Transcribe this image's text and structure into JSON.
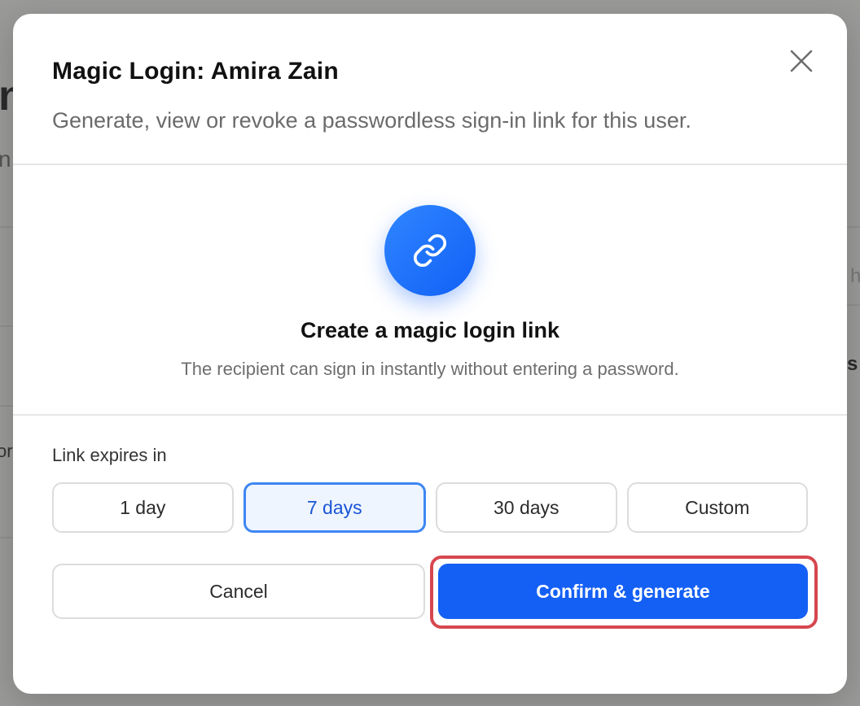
{
  "background_page": {
    "fragments": [
      "n",
      "n",
      "h",
      "s",
      "or"
    ]
  },
  "modal": {
    "title": "Magic Login: Amira Zain",
    "subtitle": "Generate, view or revoke a passwordless sign-in link for this user.",
    "close_icon": "close-icon"
  },
  "hero": {
    "icon": "link-icon",
    "title": "Create a magic login link",
    "description": "The recipient can sign in instantly without entering a password."
  },
  "expiry": {
    "label": "Link expires in",
    "options": [
      {
        "label": "1 day",
        "selected": false
      },
      {
        "label": "7 days",
        "selected": true
      },
      {
        "label": "30 days",
        "selected": false
      },
      {
        "label": "Custom",
        "selected": false
      }
    ]
  },
  "actions": {
    "cancel_label": "Cancel",
    "confirm_label": "Confirm & generate"
  },
  "colors": {
    "accent": "#1460f5",
    "selected_border": "#3d86f2",
    "highlight": "#d6474f"
  }
}
